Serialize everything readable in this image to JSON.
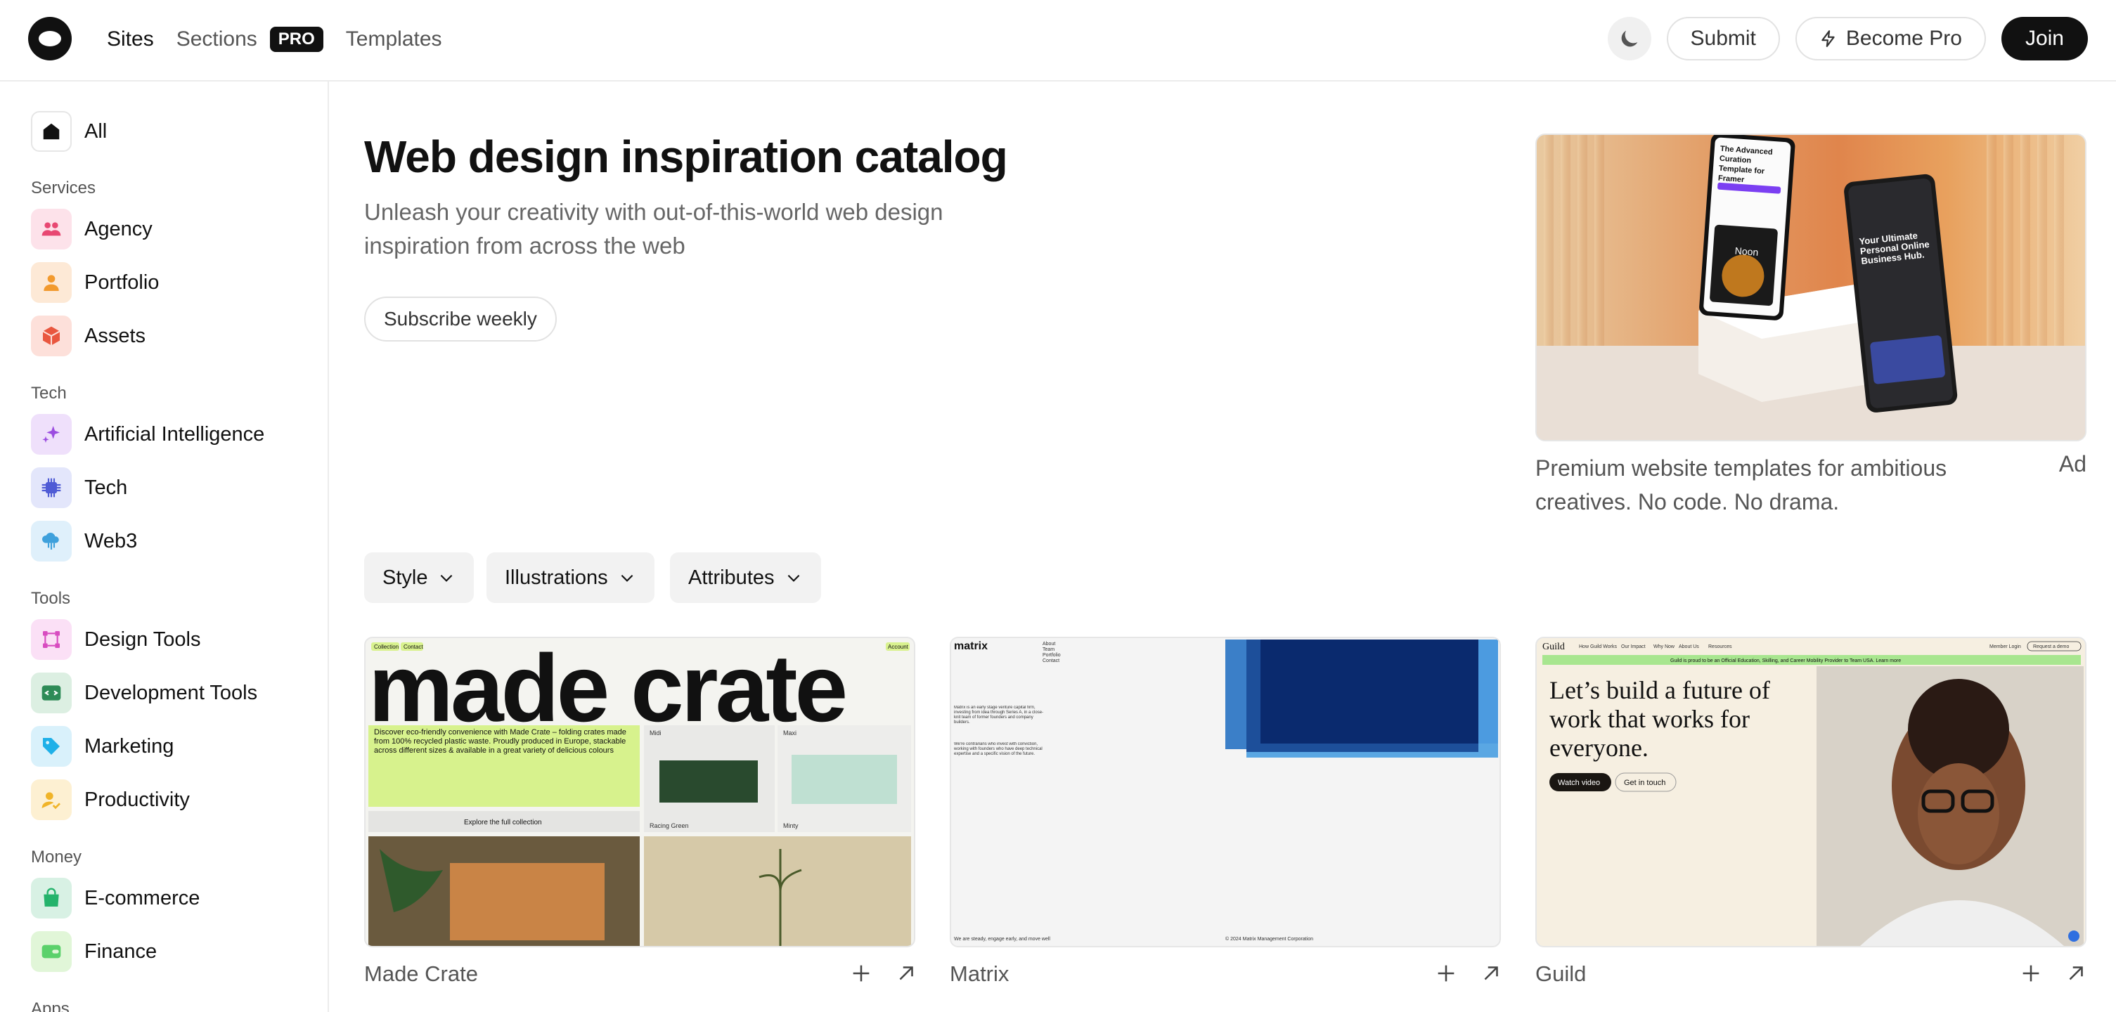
{
  "nav": {
    "items": [
      "Sites",
      "Sections",
      "Templates"
    ],
    "pro_badge": "PRO",
    "submit": "Submit",
    "become_pro": "Become Pro",
    "join": "Join"
  },
  "sidebar": {
    "all": "All",
    "groups": [
      {
        "heading": "Services",
        "items": [
          "Agency",
          "Portfolio",
          "Assets"
        ]
      },
      {
        "heading": "Tech",
        "items": [
          "Artificial Intelligence",
          "Tech",
          "Web3"
        ]
      },
      {
        "heading": "Tools",
        "items": [
          "Design Tools",
          "Development Tools",
          "Marketing",
          "Productivity"
        ]
      },
      {
        "heading": "Money",
        "items": [
          "E-commerce",
          "Finance"
        ]
      },
      {
        "heading": "Apps",
        "items": []
      }
    ]
  },
  "hero": {
    "title": "Web design inspiration catalog",
    "subtitle": "Unleash your creativity with out-of-this-world web design inspiration from across the web",
    "subscribe": "Subscribe weekly"
  },
  "ad": {
    "text": "Premium website templates for ambitious creatives. No code. No drama.",
    "label": "Ad",
    "phone1": {
      "title": "The Advanced Curation Template for Framer",
      "cta": "Noon"
    },
    "phone2": {
      "title": "Your Ultimate Personal Online Business Hub."
    }
  },
  "filters": [
    "Style",
    "Illustrations",
    "Attributes"
  ],
  "cards": [
    {
      "title": "Made Crate",
      "preview": {
        "headline": "made crate",
        "nav": [
          "Collection",
          "Contact"
        ],
        "account": "Account",
        "blurb": "Discover eco-friendly convenience with Made Crate – folding crates made from 100% recycled plastic waste. Proudly produced in Europe, stackable across different sizes & available in a great variety of delicious colours",
        "midi": "Midi",
        "maxi": "Maxi",
        "racing": "Racing Green",
        "minty": "Minty",
        "explore": "Explore the full collection"
      }
    },
    {
      "title": "Matrix",
      "preview": {
        "brand": "matrix",
        "menu": [
          "About",
          "Team",
          "Portfolio",
          "Contact"
        ],
        "para1": "Matrix is an early stage venture capital firm, investing from idea through Series A, in a close-knit team of former founders and company builders.",
        "para2": "We're contrarians who invest with conviction, working with founders who have deep technical expertise and a specific vision of the future.",
        "footer_left": "We are steady, engage early, and move well",
        "footer_right": "© 2024 Matrix Management Corporation"
      }
    },
    {
      "title": "Guild",
      "preview": {
        "brand": "Guild",
        "nav": [
          "How Guild Works",
          "Our Impact",
          "Why Now",
          "About Us",
          "Resources"
        ],
        "login": "Member Login",
        "demo": "Request a demo",
        "banner": "Guild is proud to be an Official Education, Skilling, and Career Mobility Provider to Team USA. Learn more",
        "headline": "Let’s build a future of work that works for everyone.",
        "watch": "Watch video",
        "touch": "Get in touch"
      }
    }
  ]
}
